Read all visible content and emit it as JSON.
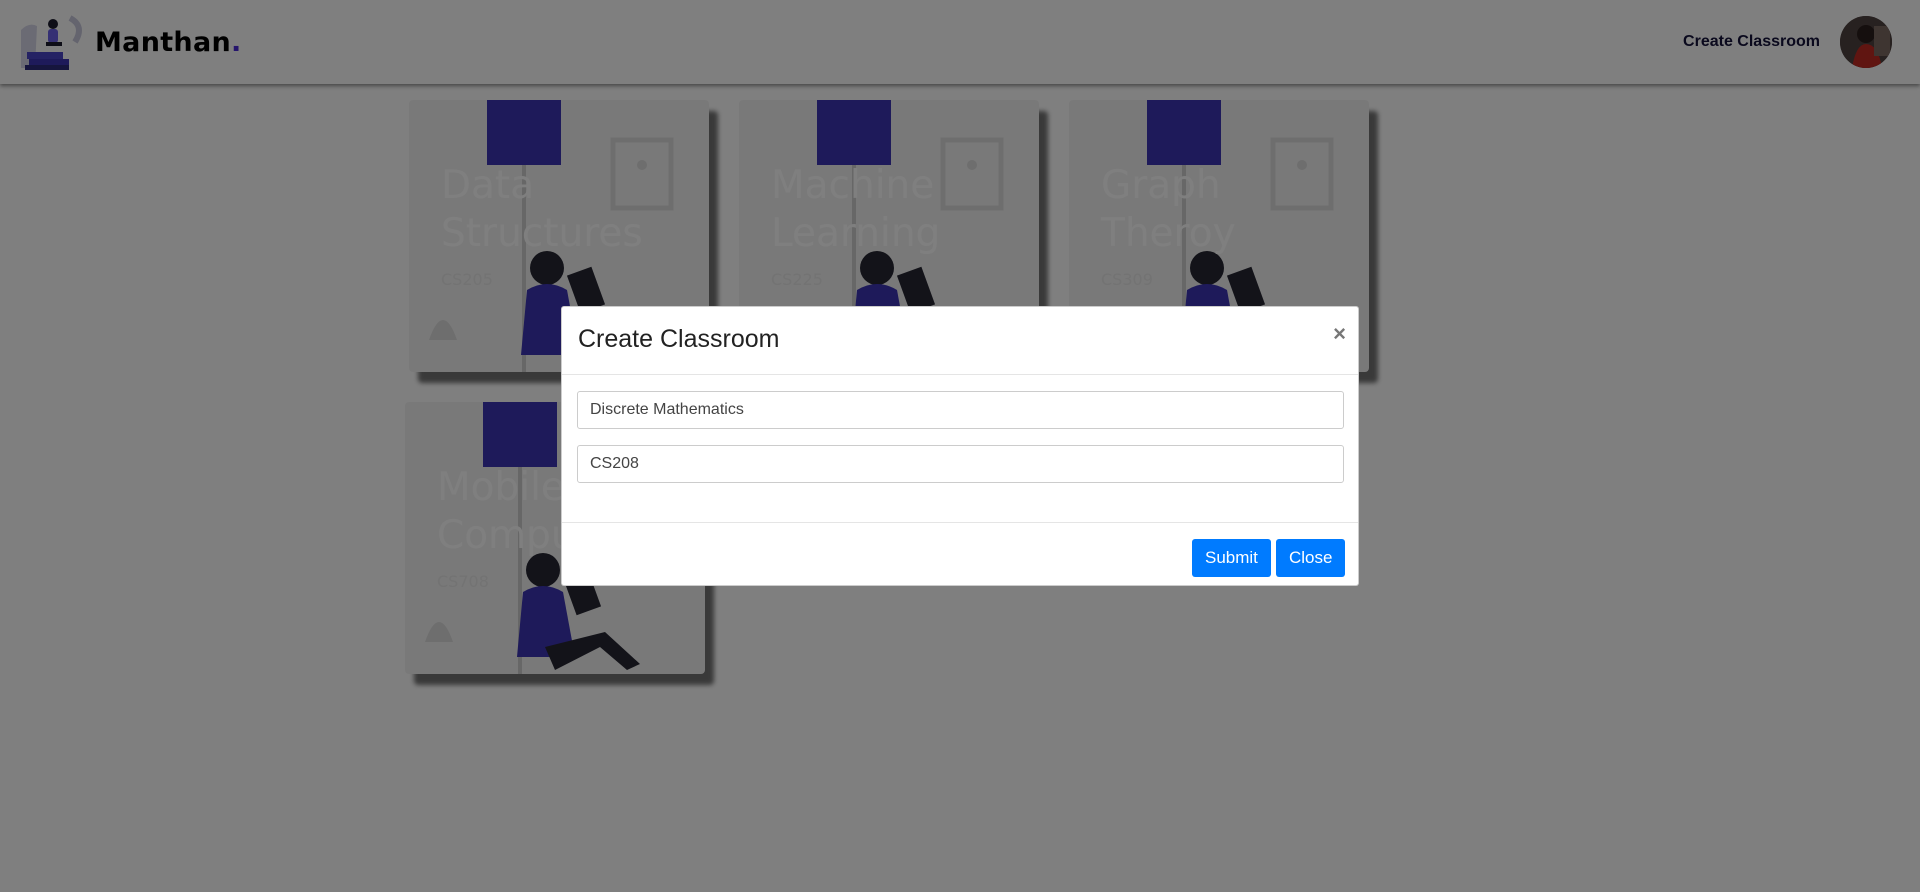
{
  "navbar": {
    "brand_name": "Manthan",
    "brand_dot": ".",
    "create_classroom_link": "Create Classroom"
  },
  "classes": [
    {
      "title_line1": "Data",
      "title_line2": "Structures",
      "code": "CS205"
    },
    {
      "title_line1": "Machine",
      "title_line2": "Learning",
      "code": "CS225"
    },
    {
      "title_line1": "Graph",
      "title_line2": "Theroy",
      "code": "CS309"
    },
    {
      "title_line1": "Mobile",
      "title_line2": "Computing",
      "code": "CS708"
    }
  ],
  "modal": {
    "title": "Create Classroom",
    "close_icon": "×",
    "fields": {
      "class_name_value": "Discrete Mathematics",
      "class_code_value": "CS208"
    },
    "submit_label": "Submit",
    "close_label": "Close"
  },
  "colors": {
    "accent": "#007bff",
    "brand_dot": "#4a2ad8",
    "illustration_purple": "#3c34b5",
    "backdrop": "rgba(0,0,0,0.5)"
  },
  "icons": [
    "brand-logo-icon",
    "avatar",
    "close-icon",
    "lamp-illustration",
    "frame-illustration",
    "reading-person-illustration",
    "plant-illustration"
  ]
}
